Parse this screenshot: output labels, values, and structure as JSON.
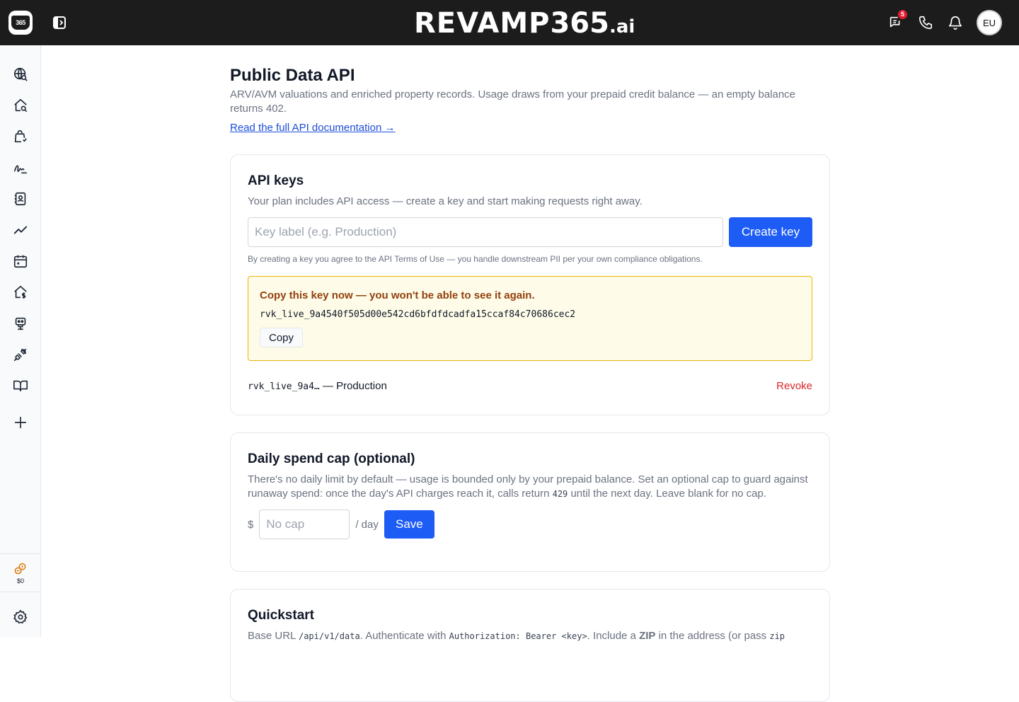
{
  "topbar": {
    "logo_text": "365",
    "brand_word": "REVAMP",
    "brand_num": "365",
    "brand_tld": ".ai",
    "messages_badge": "5",
    "user_initials": "EU"
  },
  "sidebar": {
    "items": [
      {
        "name": "sidebar-item-market-search",
        "icon": "globe-search-icon"
      },
      {
        "name": "sidebar-item-property-search",
        "icon": "house-search-icon"
      },
      {
        "name": "sidebar-item-deals",
        "icon": "shopping-bag-icon"
      },
      {
        "name": "sidebar-item-signatures",
        "icon": "signature-icon"
      },
      {
        "name": "sidebar-item-contacts",
        "icon": "contact-book-icon"
      },
      {
        "name": "sidebar-item-analytics",
        "icon": "trend-line-icon"
      },
      {
        "name": "sidebar-item-calendar",
        "icon": "calendar-icon"
      },
      {
        "name": "sidebar-item-property-value",
        "icon": "house-dollar-icon"
      },
      {
        "name": "sidebar-item-ai-agent",
        "icon": "robot-icon"
      },
      {
        "name": "sidebar-item-integrations",
        "icon": "plug-icon"
      },
      {
        "name": "sidebar-item-docs",
        "icon": "book-open-icon"
      },
      {
        "name": "sidebar-item-add",
        "icon": "plus-icon"
      }
    ],
    "credits_amount": "$0"
  },
  "page": {
    "title": "Public Data API",
    "description": "ARV/AVM valuations and enriched property records. Usage draws from your prepaid credit balance — an empty balance returns 402.",
    "doc_link": "Read the full API documentation →"
  },
  "api_keys": {
    "title": "API keys",
    "subtitle": "Your plan includes API access — create a key and start making requests right away.",
    "input_placeholder": "Key label (e.g. Production)",
    "create_button": "Create key",
    "terms": "By creating a key you agree to the API Terms of Use — you handle downstream PII per your own compliance obligations.",
    "new_key_warning": "Copy this key now — you won't be able to see it again.",
    "new_key_value": "rvk_live_9a4540f505d00e542cd6bfdfdcadfa15ccaf84c70686cec2",
    "copy_button": "Copy",
    "existing_key_prefix": "rvk_live_9a4…",
    "existing_key_label": " — Production",
    "revoke_button": "Revoke"
  },
  "spend_cap": {
    "title": "Daily spend cap (optional)",
    "desc_a": "There's no daily limit by default — usage is bounded only by your prepaid balance. Set an optional cap to guard against runaway spend: once the day's API charges reach it, calls return ",
    "desc_code": "429",
    "desc_b": " until the next day. Leave blank for no cap.",
    "currency": "$",
    "input_placeholder": "No cap",
    "per_day": "/ day",
    "save_button": "Save"
  },
  "quickstart": {
    "title": "Quickstart",
    "t1": "Base URL ",
    "c1": "/api/v1/data",
    "t2": ". Authenticate with ",
    "c2": "Authorization: Bearer <key>",
    "t3": ". Include a ",
    "t4": "ZIP",
    "t5": " in the address (or pass ",
    "c3": "zip"
  }
}
